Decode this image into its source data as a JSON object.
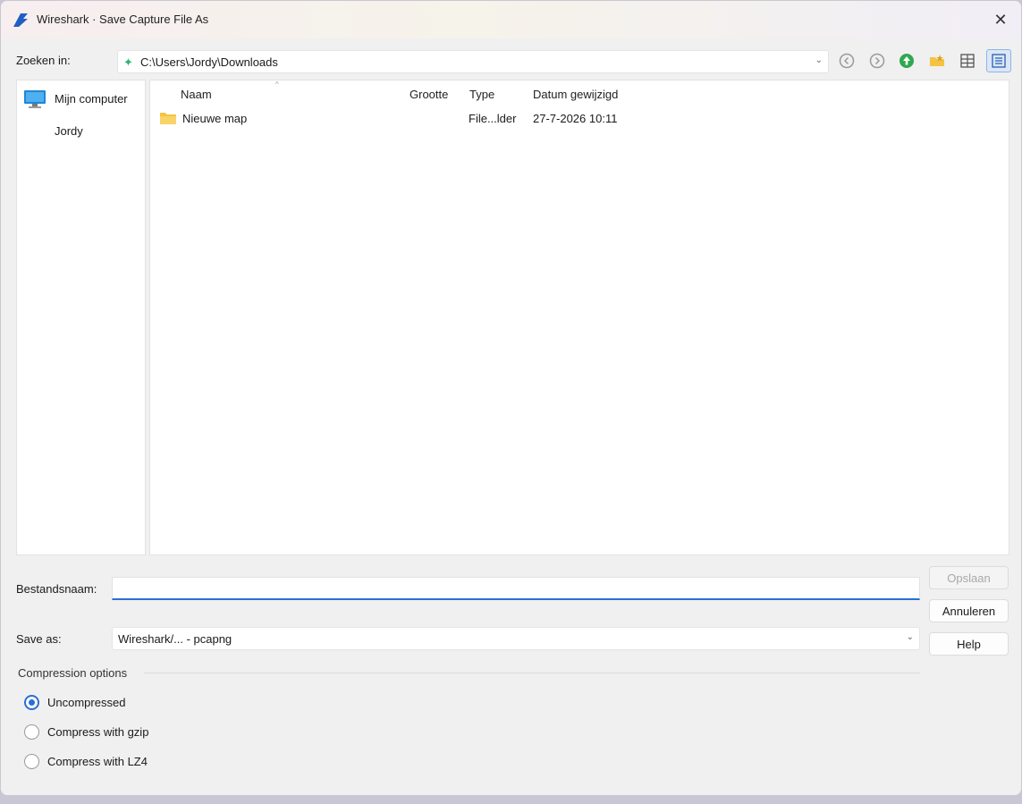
{
  "window": {
    "title": "Wireshark · Save Capture File As",
    "close_glyph": "✕"
  },
  "lookin": {
    "label": "Zoeken in:",
    "path": "C:\\Users\\Jordy\\Downloads",
    "path_icon": "✦",
    "arrow": "⌄"
  },
  "toolbar": {
    "buttons": [
      "back-icon",
      "forward-icon",
      "parent-folder-icon",
      "new-folder-icon",
      "list-view-icon",
      "detail-view-icon"
    ]
  },
  "sidebar": {
    "items": [
      {
        "label": "Mijn computer",
        "icon": "computer-icon"
      },
      {
        "label": "Jordy",
        "icon": ""
      }
    ]
  },
  "filelist": {
    "columns": [
      "Naam",
      "Grootte",
      "Type",
      "Datum gewijzigd"
    ],
    "sort_indicator": "^",
    "rows": [
      {
        "name": "Nieuwe map",
        "size": "",
        "type": "File...lder",
        "modified": "27-7-2026 10:11",
        "icon": "folder-icon"
      }
    ]
  },
  "filename": {
    "label": "Bestandsnaam:",
    "value": "",
    "placeholder": ""
  },
  "buttons": {
    "save": "Opslaan",
    "cancel": "Annuleren",
    "help": "Help"
  },
  "saveas": {
    "label": "Save as:",
    "value": "Wireshark/... - pcapng",
    "arrow": "⌄"
  },
  "compression": {
    "title": "Compression options",
    "options": [
      {
        "label": "Uncompressed",
        "checked": true
      },
      {
        "label": "Compress with gzip",
        "checked": false
      },
      {
        "label": "Compress with LZ4",
        "checked": false
      }
    ]
  },
  "colors": {
    "accent": "#2a6fd6",
    "folder": "#f5c342",
    "path_icon": "#2bb673"
  }
}
